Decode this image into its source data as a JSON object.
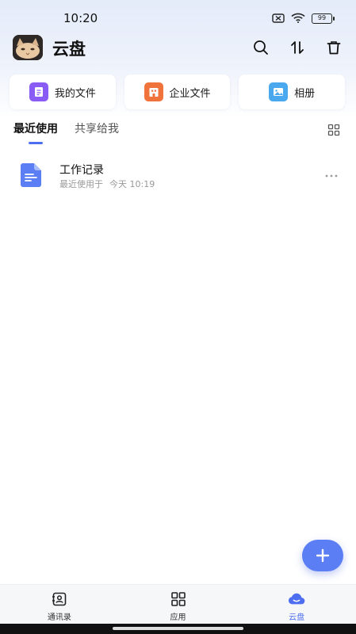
{
  "status_bar": {
    "time": "10:20",
    "battery": "99"
  },
  "header": {
    "title": "云盘"
  },
  "quick_access": [
    {
      "label": "我的文件",
      "icon": "my-files-icon",
      "color": "#8a5cf6"
    },
    {
      "label": "企业文件",
      "icon": "enterprise-files-icon",
      "color": "#f0733c"
    },
    {
      "label": "相册",
      "icon": "album-icon",
      "color": "#4aa8ee"
    }
  ],
  "tabs": [
    {
      "label": "最近使用",
      "active": true
    },
    {
      "label": "共享给我",
      "active": false
    }
  ],
  "files": [
    {
      "name": "工作记录",
      "meta_label": "最近使用于",
      "meta_time": "今天 10:19",
      "icon": "document-icon"
    }
  ],
  "bottom_nav": [
    {
      "label": "通讯录",
      "icon": "contacts-icon",
      "active": false
    },
    {
      "label": "应用",
      "icon": "apps-icon",
      "active": false
    },
    {
      "label": "云盘",
      "icon": "cloud-icon",
      "active": true
    }
  ],
  "colors": {
    "accent": "#4d6ef0",
    "fab": "#5b7ef5"
  }
}
